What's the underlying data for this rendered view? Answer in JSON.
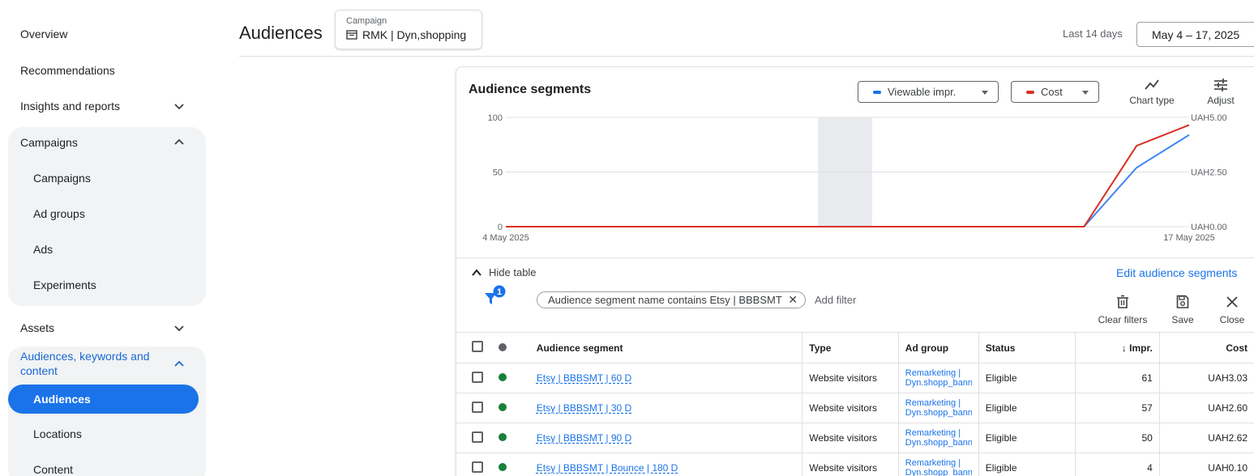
{
  "sidebar": {
    "overview": "Overview",
    "recommendations": "Recommendations",
    "insights": "Insights and reports",
    "campaigns_group": "Campaigns",
    "campaigns": "Campaigns",
    "ad_groups": "Ad groups",
    "ads": "Ads",
    "experiments": "Experiments",
    "assets": "Assets",
    "audiences_group_1": "Audiences, keywords and",
    "audiences_group_2": "content",
    "audiences": "Audiences",
    "locations": "Locations",
    "content": "Content"
  },
  "header": {
    "title": "Audiences",
    "campaign_caption": "Campaign",
    "campaign_name": "RMK | Dyn,shopping",
    "date_label": "Last 14 days",
    "date_range": "May 4 – 17, 2025"
  },
  "card": {
    "title": "Audience segments",
    "metric1": "Viewable impr.",
    "metric1_color": "#1a73e8",
    "metric2": "Cost",
    "metric2_color": "#d93025",
    "chart_type": "Chart type",
    "adjust": "Adjust"
  },
  "chart_data": {
    "type": "line",
    "x_start_label": "4 May 2025",
    "x_end_label": "17 May 2025",
    "left_ticks": [
      "100",
      "50",
      "0"
    ],
    "right_ticks": [
      "UAH5.00",
      "UAH2.50",
      "UAH0.00"
    ],
    "y_left_range": [
      0,
      100
    ],
    "y_right_range": [
      0,
      5
    ],
    "series": [
      {
        "name": "Viewable impr.",
        "axis": "left",
        "color": "#4285f4",
        "values": [
          0,
          0,
          0,
          0,
          0,
          0,
          0,
          0,
          0,
          0,
          0,
          0,
          54,
          84
        ]
      },
      {
        "name": "Cost",
        "axis": "right",
        "color": "#d93025",
        "values": [
          0,
          0,
          0,
          0,
          0,
          0,
          0,
          0,
          0,
          0,
          0,
          0,
          3.7,
          4.65
        ]
      }
    ],
    "shaded_index": 6
  },
  "table_controls": {
    "hide_table": "Hide table",
    "edit_link": "Edit audience segments",
    "filter_badge": "1",
    "filter_text": "Audience segment name contains Etsy | BBBSMT",
    "add_filter": "Add filter",
    "clear_filters": "Clear filters",
    "save": "Save",
    "close": "Close"
  },
  "table": {
    "headers": {
      "segment": "Audience segment",
      "type": "Type",
      "ad_group": "Ad group",
      "status": "Status",
      "impr": "↓ Impr.",
      "cost": "Cost"
    },
    "rows": [
      {
        "segment": "Etsy | BBBSMT | 60 D",
        "type": "Website visitors",
        "ag1": "Remarketing |",
        "ag2": "Dyn.shopp_banner",
        "status": "Eligible",
        "impr": "61",
        "cost": "UAH3.03"
      },
      {
        "segment": "Etsy | BBBSMT | 30 D",
        "type": "Website visitors",
        "ag1": "Remarketing |",
        "ag2": "Dyn.shopp_banner",
        "status": "Eligible",
        "impr": "57",
        "cost": "UAH2.60"
      },
      {
        "segment": "Etsy | BBBSMT | 90 D",
        "type": "Website visitors",
        "ag1": "Remarketing |",
        "ag2": "Dyn.shopp_banner",
        "status": "Eligible",
        "impr": "50",
        "cost": "UAH2.62"
      },
      {
        "segment": "Etsy | BBBSMT | Bounce | 180 D",
        "type": "Website visitors",
        "ag1": "Remarketing |",
        "ag2": "Dyn.shopp_banner",
        "status": "Eligible",
        "impr": "4",
        "cost": "UAH0.10"
      }
    ]
  },
  "colors": {
    "accent": "#1a73e8",
    "status_green": "#188038"
  }
}
